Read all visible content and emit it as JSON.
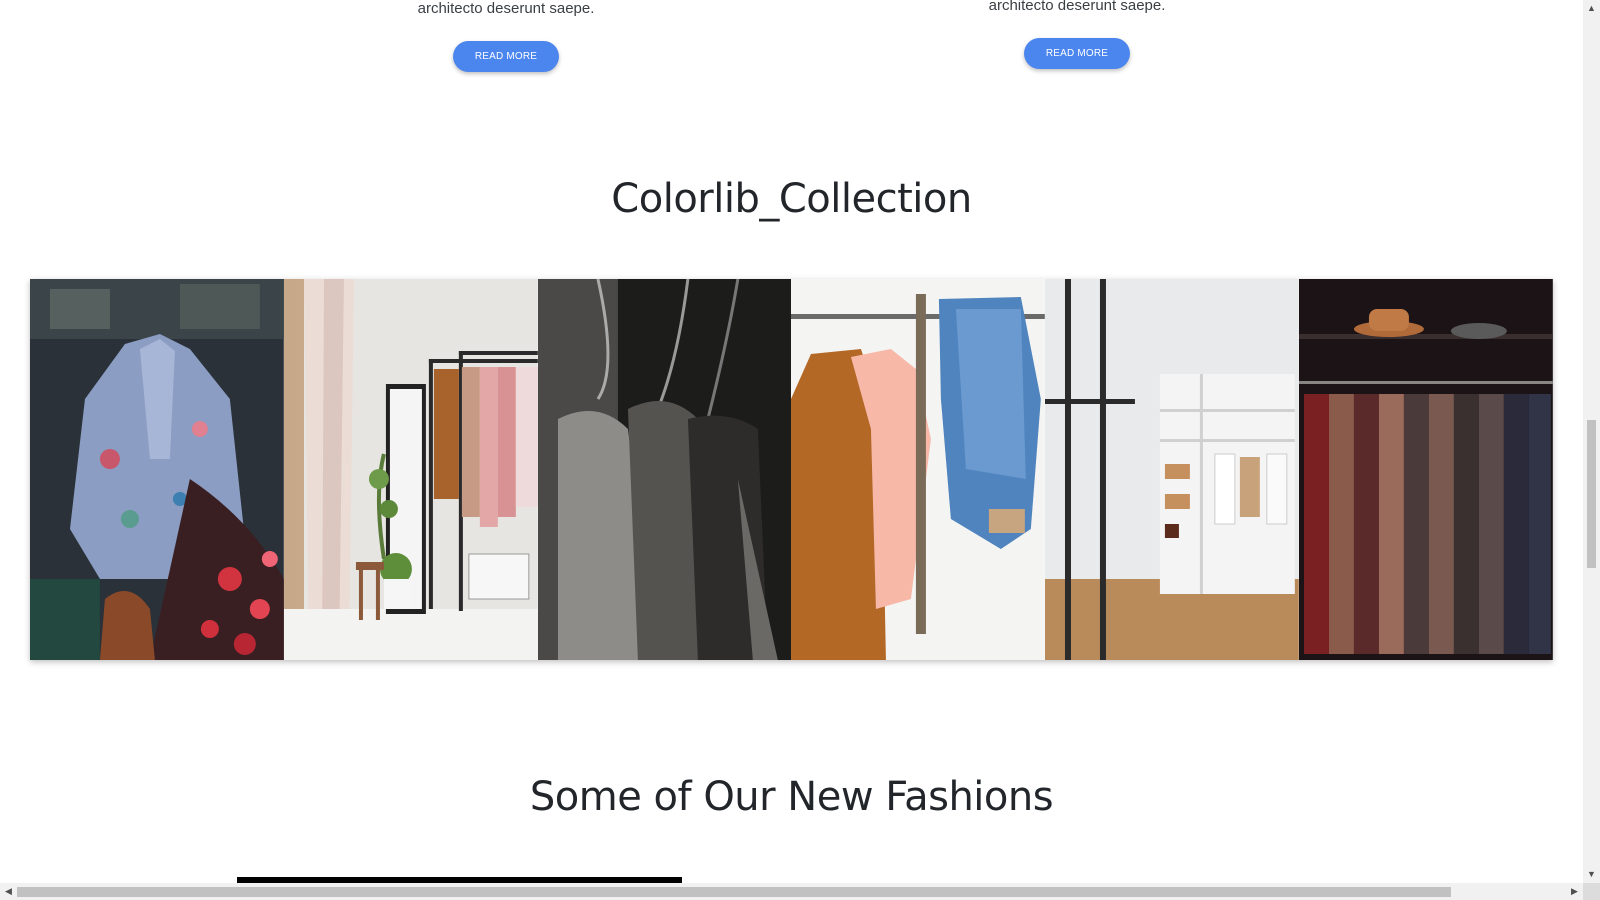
{
  "cards": [
    {
      "text": "architecto deserunt saepe.",
      "button": "READ MORE"
    },
    {
      "text": "architecto deserunt saepe.",
      "button": "READ MORE"
    }
  ],
  "collection": {
    "title": "Colorlib_Collection",
    "images": [
      {
        "name": "floral-jacket-photo"
      },
      {
        "name": "clothing-rack-room-photo"
      },
      {
        "name": "dark-shirts-on-hangers-photo"
      },
      {
        "name": "jacket-blouse-jeans-photo"
      },
      {
        "name": "white-closet-shelves-photo"
      },
      {
        "name": "patterned-shirts-rack-photo"
      }
    ]
  },
  "new_fashions": {
    "title": "Some of Our New Fashions"
  },
  "colors": {
    "accent": "#4b85ee",
    "title": "#222529"
  },
  "scrollbars": {
    "up": "▲",
    "down": "▼",
    "left": "◀",
    "right": "▶"
  }
}
